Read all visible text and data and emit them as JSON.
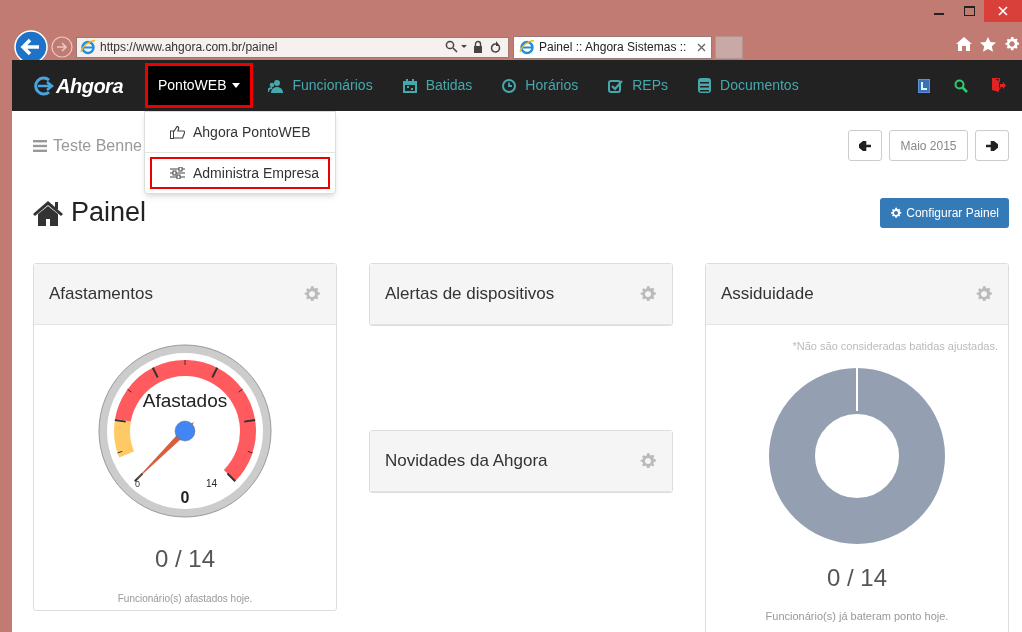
{
  "browser": {
    "address": "https://www.ahgora.com.br/painel",
    "tab_title": "Painel :: Ahgora Sistemas ::"
  },
  "navbar": {
    "brand": "Ahgora",
    "items": [
      {
        "label": "PontoWEB",
        "kind": "dropdown",
        "open": true,
        "highlighted": true
      },
      {
        "label": "Funcionários",
        "kind": "link"
      },
      {
        "label": "Batidas",
        "kind": "link"
      },
      {
        "label": "Horários",
        "kind": "link"
      },
      {
        "label": "REPs",
        "kind": "link"
      },
      {
        "label": "Documentos",
        "kind": "link"
      }
    ]
  },
  "dropdown": {
    "items": [
      {
        "label": "Ahgora PontoWEB",
        "highlighted": false
      },
      {
        "label": "Administra Empresa",
        "highlighted": true
      }
    ]
  },
  "breadcrumb": "Teste Benne",
  "period": "Maio 2015",
  "heading": "Painel",
  "config_button": "Configurar Painel",
  "columns": [
    {
      "panels": [
        {
          "title": "Afastamentos",
          "kind": "gauge",
          "gauge": {
            "label": "Afastados",
            "min": "0",
            "max": "14",
            "value": "0"
          },
          "count": "0 / 14",
          "caption": "Funcionário(s) afastados hoje."
        }
      ]
    },
    {
      "panels": [
        {
          "title": "Alertas de dispositivos",
          "kind": "empty"
        },
        {
          "title": "Novidades da Ahgora",
          "kind": "empty"
        }
      ]
    },
    {
      "panels": [
        {
          "title": "Assiduidade",
          "kind": "donut",
          "note": "*Não são consideradas batidas ajustadas.",
          "count": "0 / 14",
          "caption": "Funcionário(s) já bateram ponto hoje."
        }
      ]
    }
  ]
}
